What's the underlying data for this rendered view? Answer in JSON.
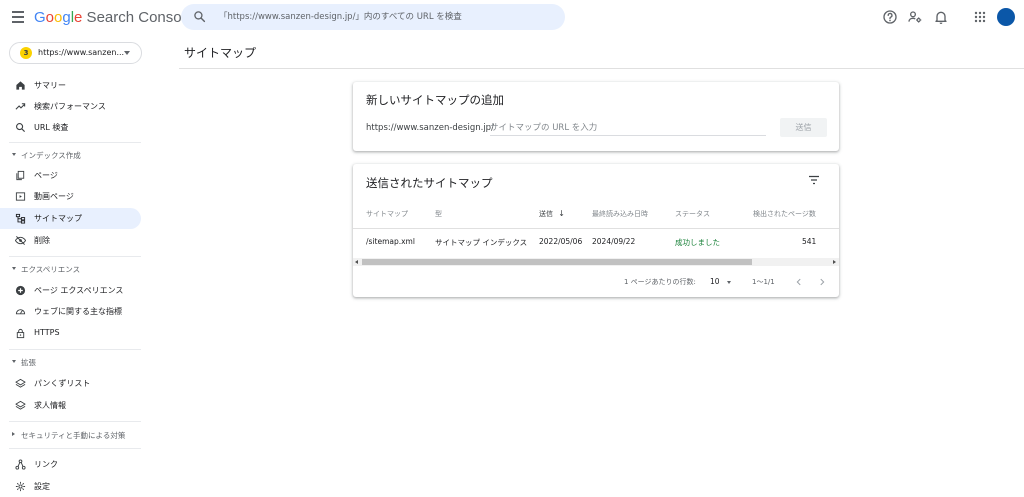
{
  "app": {
    "logo_parts": [
      "G",
      "o",
      "o",
      "g",
      "l",
      "e"
    ],
    "logo_rest": " Search Console"
  },
  "search": {
    "placeholder": "「https://www.sanzen-design.jp/」内のすべての URL を検査"
  },
  "property": {
    "badge": "3",
    "url": "https://www.sanzen..."
  },
  "sidebar": {
    "items_top": [
      {
        "label": "サマリー",
        "icon": "home-icon"
      },
      {
        "label": "検索パフォーマンス",
        "icon": "trending-up-icon"
      },
      {
        "label": "URL 検査",
        "icon": "search-icon"
      }
    ],
    "index_section": "インデックス作成",
    "index_items": [
      {
        "label": "ページ",
        "icon": "pages-icon"
      },
      {
        "label": "動画ページ",
        "icon": "video-icon"
      },
      {
        "label": "サイトマップ",
        "icon": "sitemap-icon",
        "active": true
      },
      {
        "label": "削除",
        "icon": "removal-icon"
      }
    ],
    "experience_section": "エクスペリエンス",
    "experience_items": [
      {
        "label": "ページ エクスペリエンス",
        "icon": "plus-circle-icon"
      },
      {
        "label": "ウェブに関する主な指標",
        "icon": "speedometer-icon"
      },
      {
        "label": "HTTPS",
        "icon": "lock-icon"
      }
    ],
    "enhancements_section": "拡張",
    "enhancements_items": [
      {
        "label": "パンくずリスト",
        "icon": "layers-icon"
      },
      {
        "label": "求人情報",
        "icon": "layers-icon"
      }
    ],
    "security_section": "セキュリティと手動による対策",
    "bottom_items": [
      {
        "label": "リンク",
        "icon": "links-icon"
      },
      {
        "label": "設定",
        "icon": "settings-icon"
      }
    ]
  },
  "main": {
    "page_title": "サイトマップ"
  },
  "add_card": {
    "title": "新しいサイトマップの追加",
    "prefix": "https://www.sanzen-design.jp/",
    "input_placeholder": "サイトマップの URL を入力",
    "input_value": "",
    "submit_label": "送信"
  },
  "submitted_card": {
    "title": "送信されたサイトマップ",
    "columns": [
      "サイトマップ",
      "型",
      "送信",
      "最終読み込み日時",
      "ステータス",
      "検出されたページ数"
    ],
    "sort_arrow": "↓",
    "rows": [
      {
        "sitemap": "/sitemap.xml",
        "type": "サイトマップ インデックス",
        "submitted": "2022/05/06",
        "last_read": "2024/09/22",
        "status": "成功しました",
        "pages": "541"
      }
    ],
    "rows_per_page_label": "1 ページあたりの行数:",
    "rows_per_page": "10",
    "range": "1〜1/1"
  },
  "colors": {
    "accent": "#1a73e8",
    "active_bg": "#e8f0fe",
    "success": "#188038",
    "avatar": "#0b57a8"
  }
}
